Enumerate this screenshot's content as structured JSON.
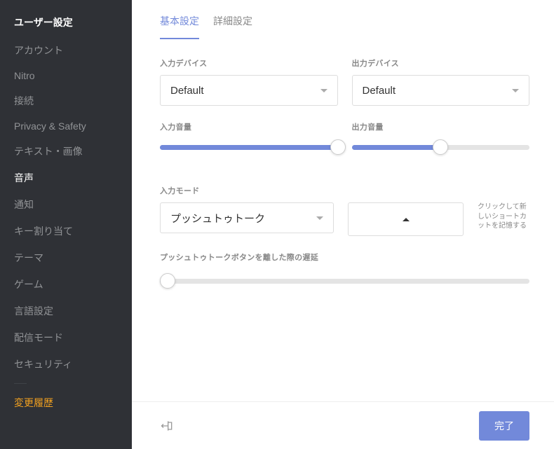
{
  "sidebar": {
    "header": "ユーザー設定",
    "items": [
      {
        "label": "アカウント",
        "active": false
      },
      {
        "label": "Nitro",
        "active": false
      },
      {
        "label": "接続",
        "active": false
      },
      {
        "label": "Privacy & Safety",
        "active": false
      },
      {
        "label": "テキスト・画像",
        "active": false
      },
      {
        "label": "音声",
        "active": true
      },
      {
        "label": "通知",
        "active": false
      },
      {
        "label": "キー割り当て",
        "active": false
      },
      {
        "label": "テーマ",
        "active": false
      },
      {
        "label": "ゲーム",
        "active": false
      },
      {
        "label": "言語設定",
        "active": false
      },
      {
        "label": "配信モード",
        "active": false
      },
      {
        "label": "セキュリティ",
        "active": false
      }
    ],
    "changelog": "変更履歴"
  },
  "tabs": [
    {
      "label": "基本設定",
      "active": true
    },
    {
      "label": "詳細設定",
      "active": false
    }
  ],
  "inputDevice": {
    "label": "入力デバイス",
    "value": "Default"
  },
  "outputDevice": {
    "label": "出力デバイス",
    "value": "Default"
  },
  "inputVolume": {
    "label": "入力音量",
    "percent": 100
  },
  "outputVolume": {
    "label": "出力音量",
    "percent": 50
  },
  "inputMode": {
    "label": "入力モード",
    "value": "プッシュトゥトーク"
  },
  "shortcutHint": "クリックして新しいショートカットを記憶する",
  "pttDelay": {
    "label": "プッシュトゥトークボタンを離した際の遅延",
    "percent": 2
  },
  "footer": {
    "done": "完了"
  }
}
